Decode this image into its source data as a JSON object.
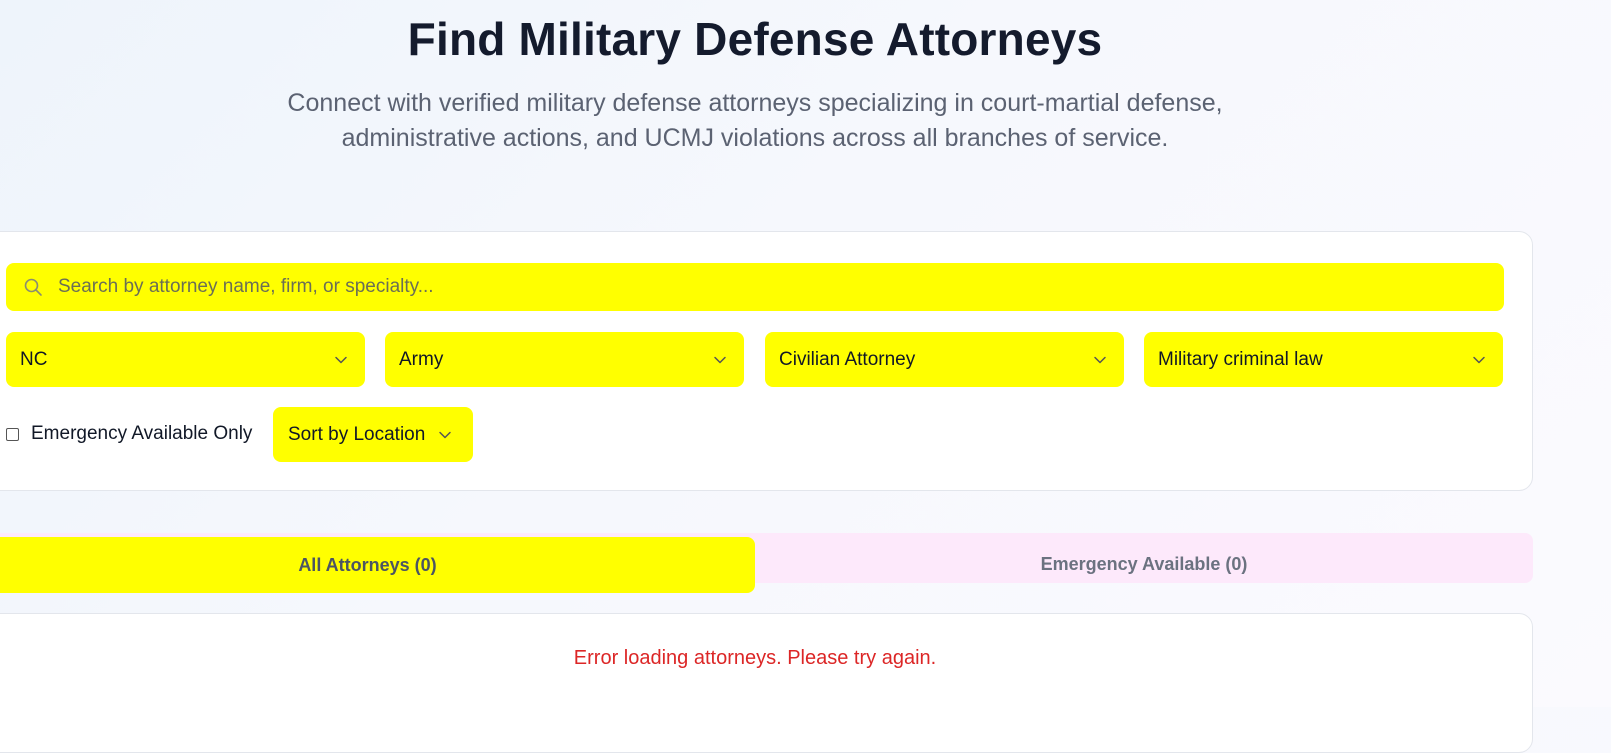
{
  "header": {
    "title": "Find Military Defense Attorneys",
    "subtitle": "Connect with verified military defense attorneys specializing in court-martial defense, administrative actions, and UCMJ violations across all branches of service."
  },
  "filters": {
    "search": {
      "placeholder": "Search by attorney name, firm, or specialty...",
      "value": "",
      "icon": "search-icon"
    },
    "state": {
      "selected": "NC"
    },
    "branch": {
      "selected": "Army"
    },
    "attorney_type": {
      "selected": "Civilian Attorney"
    },
    "practice_area": {
      "selected": "Military criminal law"
    },
    "emergency_checkbox": {
      "label": "Emergency Available Only",
      "checked": false
    },
    "sort": {
      "selected": "Sort by Location"
    }
  },
  "tabs": [
    {
      "label": "All Attorneys (0)",
      "active": true
    },
    {
      "label": "Emergency Available (0)",
      "active": false
    }
  ],
  "results": {
    "error_message": "Error loading attorneys. Please try again."
  },
  "colors": {
    "highlight": "#ffff00",
    "title": "#141b2d",
    "subtitle": "#5b6272",
    "error": "#dc2626",
    "tabs_bar": "#fde9fb"
  }
}
